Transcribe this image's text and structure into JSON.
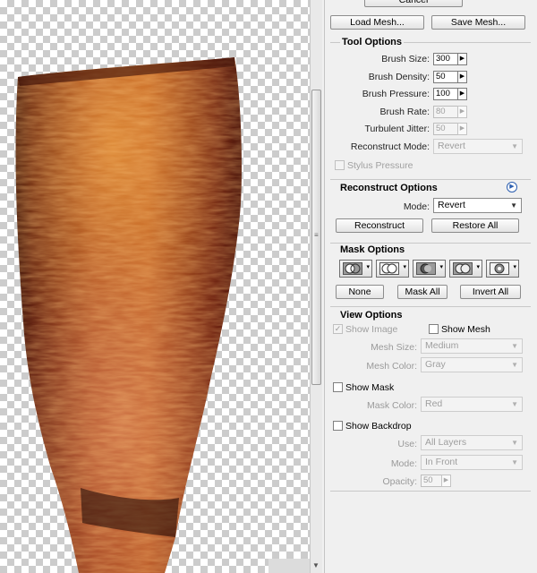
{
  "top_buttons": {
    "cancel": "Cancel",
    "load_mesh": "Load Mesh...",
    "save_mesh": "Save Mesh..."
  },
  "tool_options": {
    "title": "Tool Options",
    "brush_size_label": "Brush Size:",
    "brush_size": "300",
    "brush_density_label": "Brush Density:",
    "brush_density": "50",
    "brush_pressure_label": "Brush Pressure:",
    "brush_pressure": "100",
    "brush_rate_label": "Brush Rate:",
    "brush_rate": "80",
    "turbulent_jitter_label": "Turbulent Jitter:",
    "turbulent_jitter": "50",
    "reconstruct_mode_label": "Reconstruct Mode:",
    "reconstruct_mode": "Revert",
    "stylus_pressure_label": "Stylus Pressure"
  },
  "reconstruct_options": {
    "title": "Reconstruct Options",
    "mode_label": "Mode:",
    "mode": "Revert",
    "reconstruct": "Reconstruct",
    "restore_all": "Restore All"
  },
  "mask_options": {
    "title": "Mask Options",
    "none": "None",
    "mask_all": "Mask All",
    "invert_all": "Invert All"
  },
  "view_options": {
    "title": "View Options",
    "show_image_label": "Show Image",
    "show_image_checked": true,
    "show_mesh_label": "Show Mesh",
    "show_mesh_checked": false,
    "mesh_size_label": "Mesh Size:",
    "mesh_size": "Medium",
    "mesh_color_label": "Mesh Color:",
    "mesh_color": "Gray",
    "show_mask_label": "Show Mask",
    "show_mask_checked": false,
    "mask_color_label": "Mask Color:",
    "mask_color": "Red",
    "show_backdrop_label": "Show Backdrop",
    "show_backdrop_checked": false,
    "use_label": "Use:",
    "use": "All Layers",
    "mode_label": "Mode:",
    "mode": "In Front",
    "opacity_label": "Opacity:",
    "opacity": "50"
  },
  "icons": {
    "info": "info-circle-icon",
    "dropdown": "triangle-down-icon",
    "stepper": "triangle-right-icon",
    "grip": "scroll-grip-icon"
  },
  "colors": {
    "panel_bg": "#f0f0f0",
    "accent": "#2d5fb0",
    "object_dark": "#3a0d06",
    "object_bright": "#e0902e"
  }
}
